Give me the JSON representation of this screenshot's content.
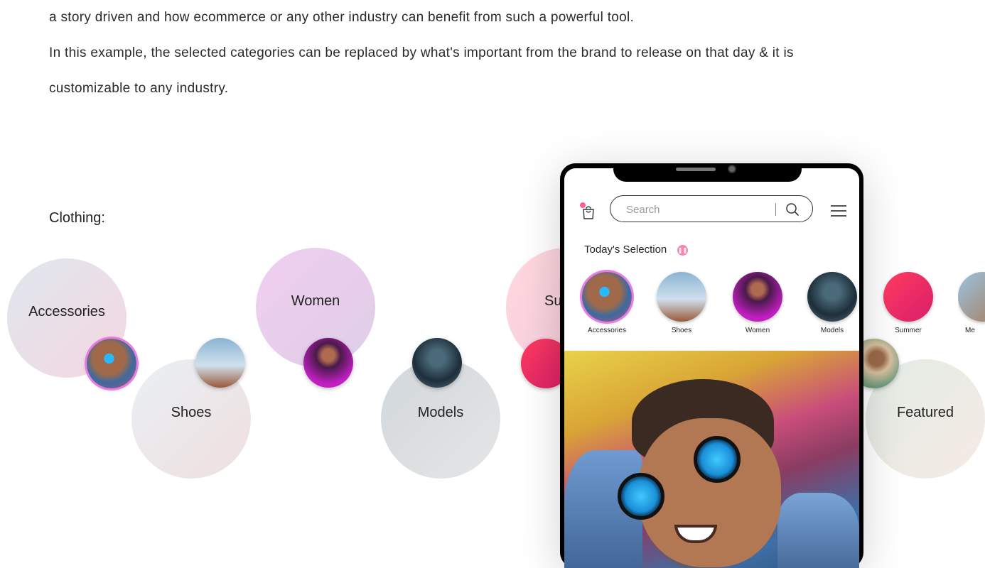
{
  "intro": {
    "line1": "a story driven and how ecommerce or any other industry can benefit from such a powerful tool.",
    "line2": "In this example, the selected categories can be replaced by what's important from the brand to release on that day & it is",
    "line3": "customizable to any industry."
  },
  "section_label": "Clothing:",
  "bubbles": [
    {
      "label": "Accessories"
    },
    {
      "label": "Women"
    },
    {
      "label": "Su"
    },
    {
      "label": "Shoes"
    },
    {
      "label": "Models"
    },
    {
      "label": "Featured"
    }
  ],
  "phone": {
    "search": {
      "placeholder": "Search"
    },
    "section_title": "Today's Selection",
    "live_icon": "pause-icon",
    "categories": [
      {
        "label": "Accessories",
        "selected": true
      },
      {
        "label": "Shoes"
      },
      {
        "label": "Women"
      },
      {
        "label": "Models"
      },
      {
        "label": "Summer"
      },
      {
        "label": "Me"
      }
    ]
  },
  "colors": {
    "accent_ring": "#e87be8",
    "badge": "#ff5f8f"
  }
}
